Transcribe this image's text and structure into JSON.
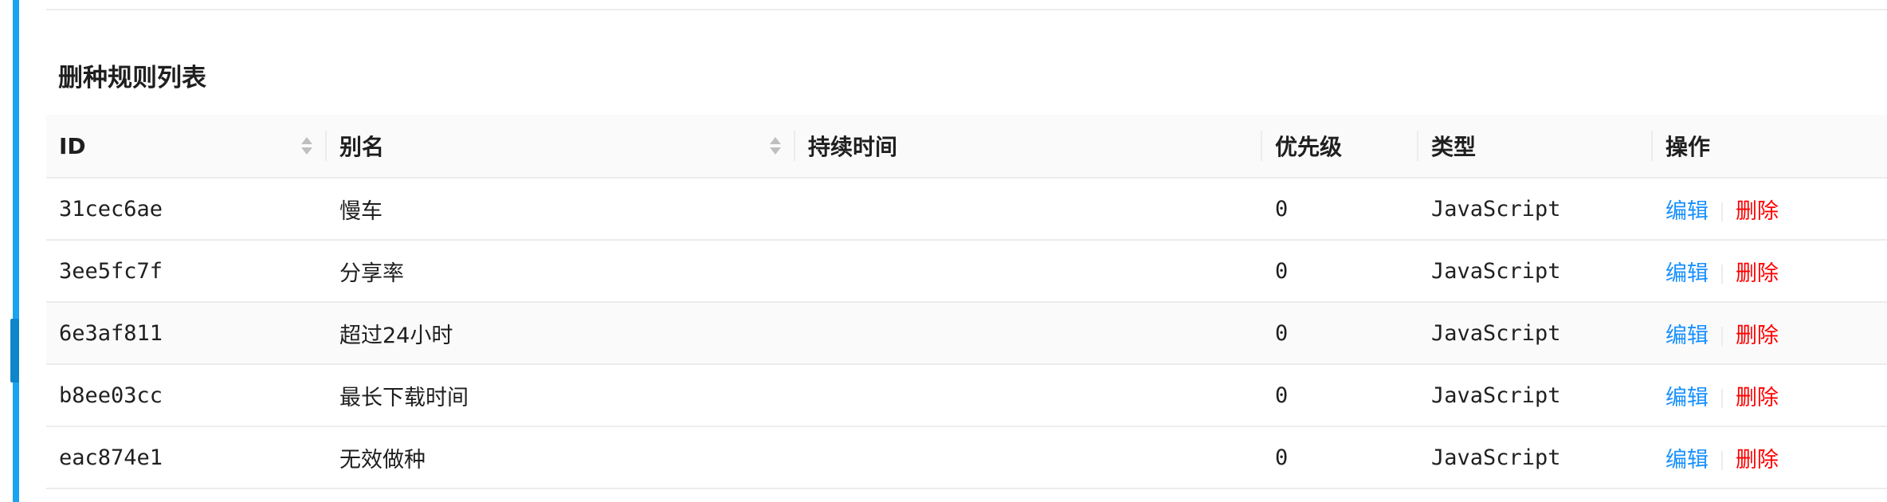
{
  "section": {
    "title": "删种规则列表"
  },
  "table": {
    "columns": {
      "id": "ID",
      "alias": "别名",
      "duration": "持续时间",
      "priority": "优先级",
      "type": "类型",
      "actions": "操作"
    },
    "rows": [
      {
        "id": "31cec6ae",
        "alias": "慢车",
        "duration": "",
        "priority": "0",
        "type": "JavaScript",
        "edit": "编辑",
        "delete": "删除"
      },
      {
        "id": "3ee5fc7f",
        "alias": "分享率",
        "duration": "",
        "priority": "0",
        "type": "JavaScript",
        "edit": "编辑",
        "delete": "删除"
      },
      {
        "id": "6e3af811",
        "alias": "超过24小时",
        "duration": "",
        "priority": "0",
        "type": "JavaScript",
        "edit": "编辑",
        "delete": "删除"
      },
      {
        "id": "b8ee03cc",
        "alias": "最长下载时间",
        "duration": "",
        "priority": "0",
        "type": "JavaScript",
        "edit": "编辑",
        "delete": "删除"
      },
      {
        "id": "eac874e1",
        "alias": "无效做种",
        "duration": "",
        "priority": "0",
        "type": "JavaScript",
        "edit": "编辑",
        "delete": "删除"
      }
    ]
  },
  "colors": {
    "accent_bar": "#1aa3f0",
    "link": "#1890ff",
    "danger": "#ff0000"
  },
  "icons": {
    "sort": "sort-caret-icon"
  }
}
